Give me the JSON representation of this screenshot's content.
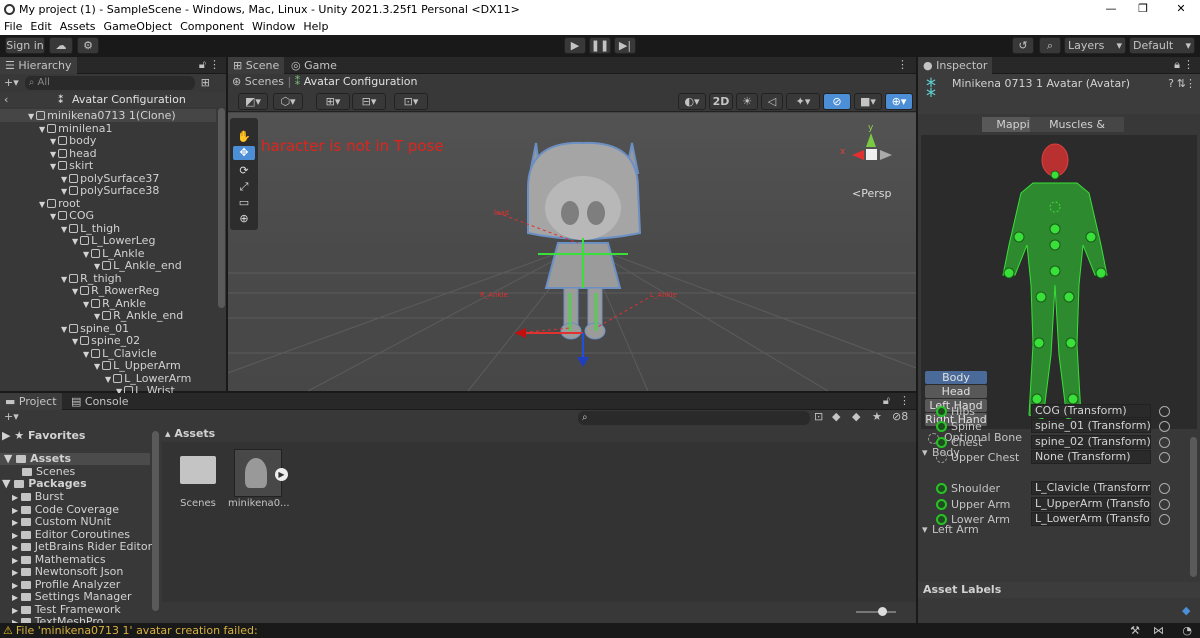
{
  "window": {
    "title": "My project (1) - SampleScene - Windows, Mac, Linux - Unity 2021.3.25f1 Personal <DX11>",
    "minimize": "—",
    "maximize": "❐",
    "close": "✕"
  },
  "menu": [
    "File",
    "Edit",
    "Assets",
    "GameObject",
    "Component",
    "Window",
    "Help"
  ],
  "toolbar": {
    "sign_in": "Sign in",
    "layers": "Layers",
    "layout": "Default"
  },
  "hierarchy": {
    "title": "Hierarchy",
    "search_placeholder": "All",
    "context": "Avatar Configuration",
    "rows": [
      {
        "label": "minikena0713 1(Clone)",
        "depth": 0
      },
      {
        "label": "minilena1",
        "depth": 1
      },
      {
        "label": "body",
        "depth": 2
      },
      {
        "label": "head",
        "depth": 2
      },
      {
        "label": "skirt",
        "depth": 2
      },
      {
        "label": "polySurface37",
        "depth": 3
      },
      {
        "label": "polySurface38",
        "depth": 3
      },
      {
        "label": "root",
        "depth": 1
      },
      {
        "label": "COG",
        "depth": 2
      },
      {
        "label": "L_thigh",
        "depth": 3
      },
      {
        "label": "L_LowerLeg",
        "depth": 4
      },
      {
        "label": "L_Ankle",
        "depth": 5
      },
      {
        "label": "L_Ankle_end",
        "depth": 6
      },
      {
        "label": "R_thigh",
        "depth": 3
      },
      {
        "label": "R_RowerReg",
        "depth": 4
      },
      {
        "label": "R_Ankle",
        "depth": 5
      },
      {
        "label": "R_Ankle_end",
        "depth": 6
      },
      {
        "label": "spine_01",
        "depth": 3
      },
      {
        "label": "spine_02",
        "depth": 4
      },
      {
        "label": "L_Clavicle",
        "depth": 5
      },
      {
        "label": "L_UpperArm",
        "depth": 6
      },
      {
        "label": "L_LowerArm",
        "depth": 7
      },
      {
        "label": "L_Wrist",
        "depth": 8
      }
    ]
  },
  "scene": {
    "tab_scene": "Scene",
    "tab_game": "Game",
    "breadcrumb_root": "Scenes",
    "breadcrumb_current": "Avatar Configuration",
    "mode_2d": "2D",
    "warning": "haracter is not in T pose",
    "persp": "<Persp",
    "gizmo_y": "y",
    "gizmo_x": "x"
  },
  "inspector": {
    "title": "Inspector",
    "object_name": "Minikena 0713 1 Avatar (Avatar)",
    "tab_mapping": "Mapping",
    "tab_muscles": "Muscles & Settings",
    "body_buttons": [
      "Body",
      "Head",
      "Left Hand",
      "Right Hand"
    ],
    "optional_bone": "Optional Bone",
    "group_body": "Body",
    "group_left_arm": "Left Arm",
    "bones": [
      {
        "label": "Hips",
        "value": "COG (Transform)"
      },
      {
        "label": "Spine",
        "value": "spine_01 (Transform)"
      },
      {
        "label": "Chest",
        "value": "spine_02 (Transform)"
      },
      {
        "label": "Upper Chest",
        "value": "None (Transform)"
      },
      {
        "label": "Shoulder",
        "value": "L_Clavicle (Transform)"
      },
      {
        "label": "Upper Arm",
        "value": "L_UpperArm (Transform)"
      },
      {
        "label": "Lower Arm",
        "value": "L_LowerArm (Transform)"
      }
    ],
    "asset_labels": "Asset Labels"
  },
  "project": {
    "tab_project": "Project",
    "tab_console": "Console",
    "favorites": "Favorites",
    "assets": "Assets",
    "scenes": "Scenes",
    "packages": "Packages",
    "package_list": [
      "Burst",
      "Code Coverage",
      "Custom NUnit",
      "Editor Coroutines",
      "JetBrains Rider Editor",
      "Mathematics",
      "Newtonsoft Json",
      "Profile Analyzer",
      "Settings Manager",
      "Test Framework",
      "TextMeshPro"
    ],
    "breadcrumb": "Assets",
    "items": [
      {
        "label": "Scenes"
      },
      {
        "label": "minikena0..."
      }
    ],
    "hidden_count": "8"
  },
  "status": {
    "message": "File 'minikena0713 1' avatar creation failed:"
  },
  "colors": {
    "accent": "#4d8fd6",
    "bone_ok": "#27c227",
    "warning": "#d8b13c",
    "error_text": "#e0241c"
  }
}
